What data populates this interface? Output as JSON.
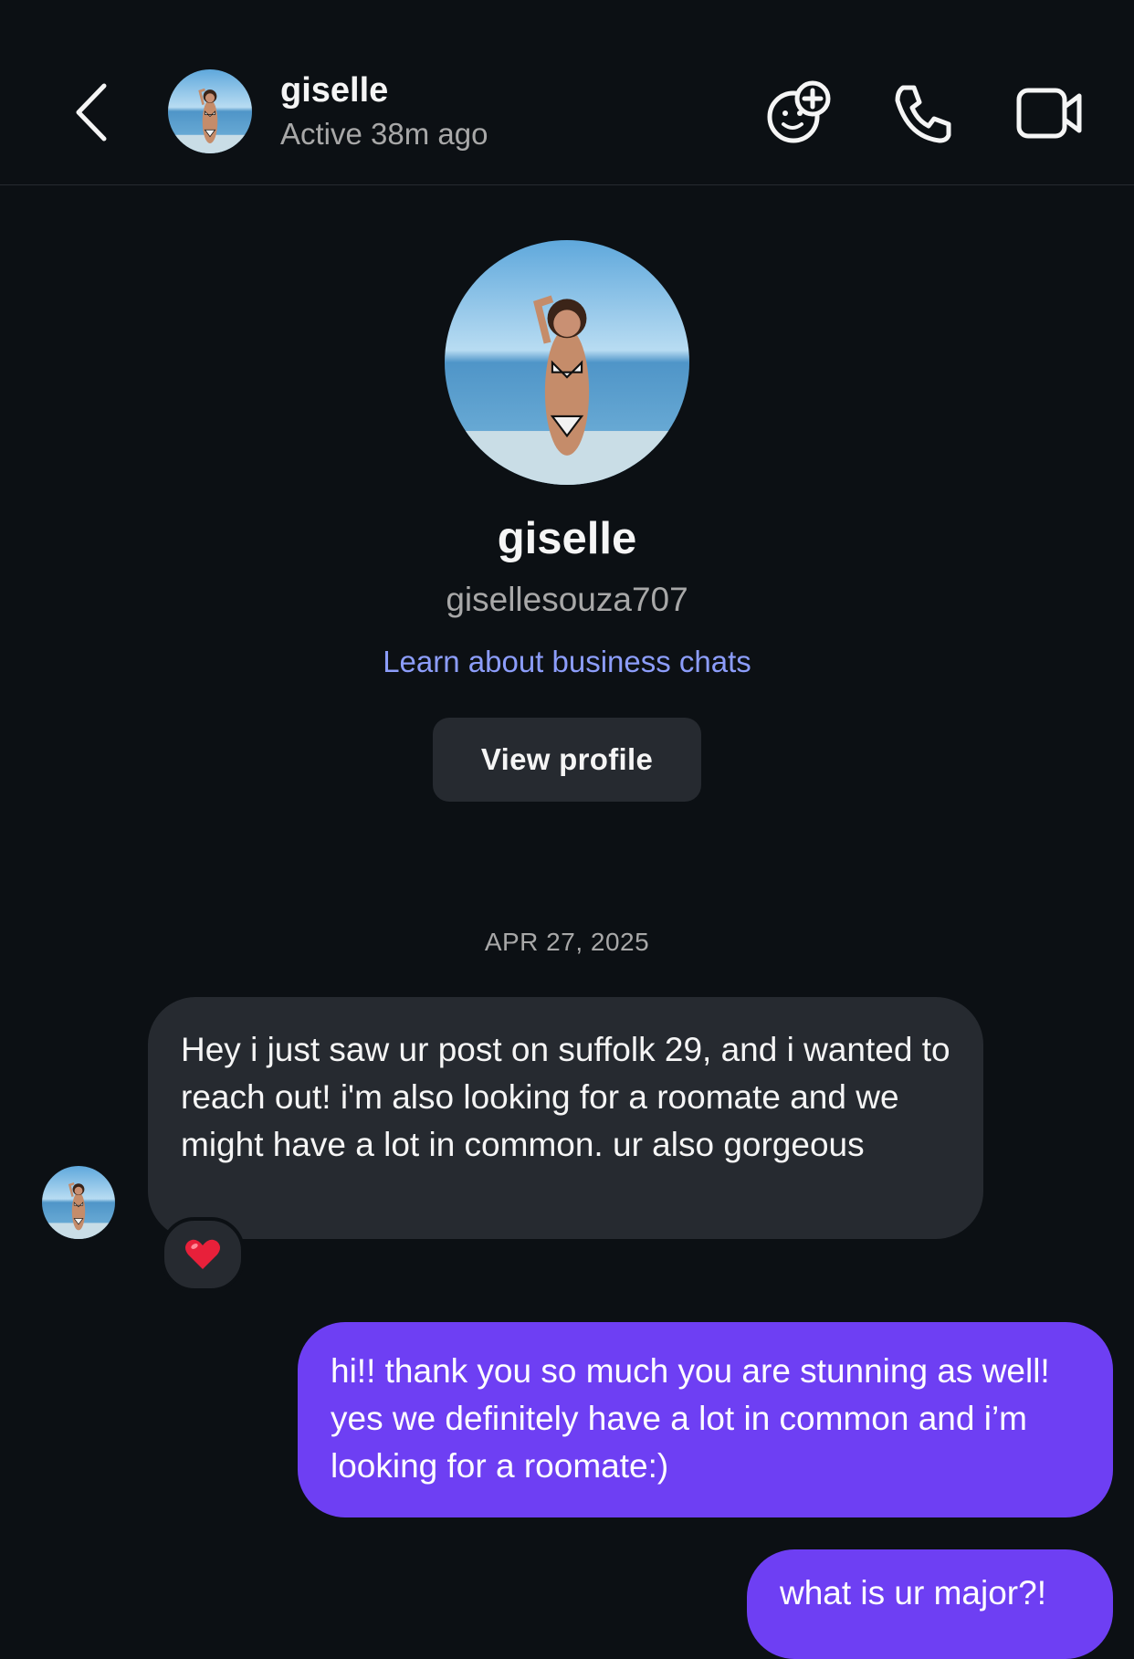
{
  "header": {
    "name": "giselle",
    "status": "Active 38m ago",
    "icons": [
      "back-chevron-icon",
      "add-friend-emoji-icon",
      "phone-icon",
      "video-icon"
    ]
  },
  "profile": {
    "name": "giselle",
    "username": "gisellesouza707",
    "business_link": "Learn about business chats",
    "view_profile_label": "View profile"
  },
  "thread": {
    "date": "APR 27, 2025",
    "messages": [
      {
        "from": "them",
        "text": "Hey i just saw ur post on suffolk 29, and i wanted to reach out! i'm also looking for a roomate and we might have a lot in common. ur also gorgeous",
        "reaction": "❤️"
      },
      {
        "from": "me",
        "text": "hi!! thank you so much you are stunning as well! yes we definitely have a lot in common and i’m looking for a roomate:)"
      },
      {
        "from": "me",
        "text": "what is ur major?!"
      }
    ]
  },
  "colors": {
    "background": "#0c1014",
    "incoming_bubble": "#262a30",
    "outgoing_bubble": "#6e3ff3",
    "link": "#8c9dfa",
    "secondary_text": "#a8a8a8"
  }
}
